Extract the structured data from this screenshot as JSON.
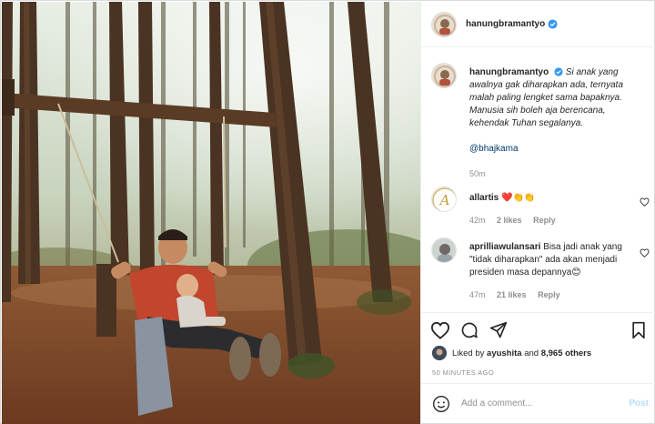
{
  "post": {
    "username": "hanungbramantyo",
    "caption": "Si anak yang awalnya gak diharapkan ada, ternyata malah paling lengket sama bapaknya. Manusia sih boleh aja berencana, kehendak Tuhan segalanya.",
    "mention": "@bhajkama",
    "caption_time": "50m"
  },
  "comments": [
    {
      "username": "allartis",
      "text": "❤️👏👏",
      "time": "42m",
      "likes": "2 likes",
      "reply": "Reply"
    },
    {
      "username": "aprilliawulansari",
      "text": "Bisa jadi anak yang \"tidak diharapkan\" ada akan menjadi presiden masa depannya😊",
      "time": "47m",
      "likes": "21 likes",
      "reply": "Reply"
    }
  ],
  "likes": {
    "prefix": "Liked by",
    "user": "ayushita",
    "joiner": "and",
    "others": "8,965 others"
  },
  "timestamp": "50 MINUTES AGO",
  "add_comment": {
    "placeholder": "Add a comment...",
    "post_label": "Post"
  },
  "icons": {
    "like": "heart-icon",
    "comment": "comment-icon",
    "share": "share-icon",
    "save": "bookmark-icon",
    "emoji": "smiley-icon",
    "verified": "verified-badge-icon"
  },
  "colors": {
    "verified": "#3897f0",
    "link": "#00376b",
    "muted": "#8e8e8e",
    "post_disabled": "#b2dffc"
  }
}
